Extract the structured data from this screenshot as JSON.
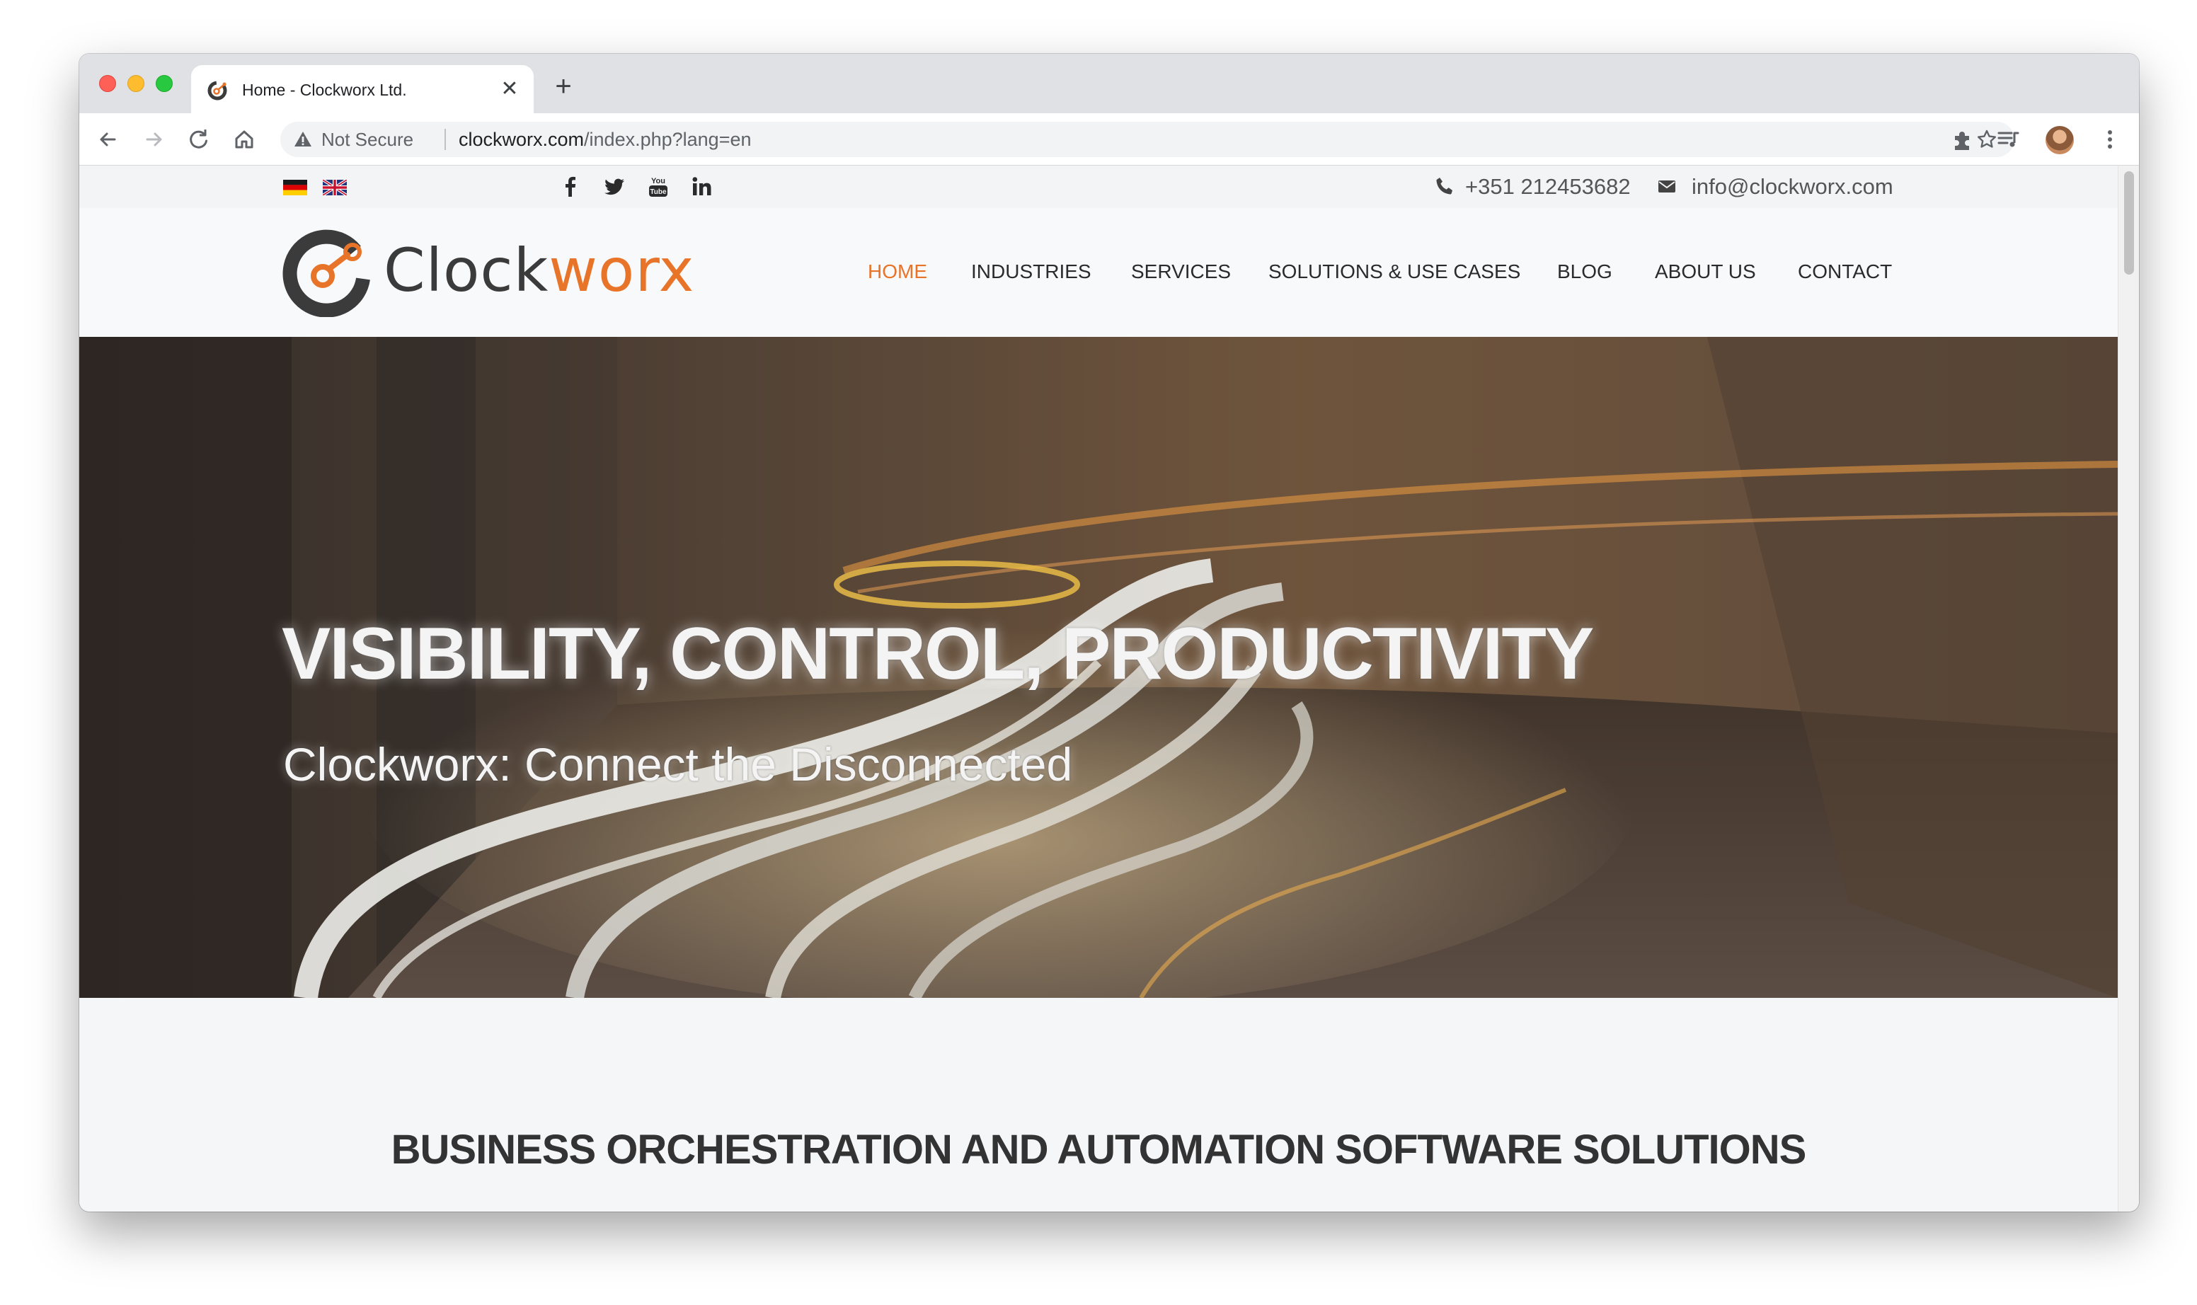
{
  "browser": {
    "tab_title": "Home - Clockworx Ltd.",
    "tab_close": "✕",
    "new_tab": "+",
    "security_label": "Not Secure",
    "url_domain": "clockworx.com",
    "url_path": "/index.php?lang=en"
  },
  "topbar": {
    "languages": [
      "German",
      "English"
    ],
    "social": [
      "facebook-icon",
      "twitter-icon",
      "youtube-icon",
      "linkedin-icon"
    ],
    "phone": "+351 212453682",
    "email": "info@clockworx.com"
  },
  "logo": {
    "part1": "Clock",
    "part2": "worx"
  },
  "nav": {
    "home": "HOME",
    "industries": "INDUSTRIES",
    "services": "SERVICES",
    "solutions": "SOLUTIONS & USE CASES",
    "blog": "BLOG",
    "about": "ABOUT US",
    "contact": "CONTACT"
  },
  "hero": {
    "title": "VISIBILITY, CONTROL, PRODUCTIVITY",
    "subtitle": "Clockworx: Connect the Disconnected"
  },
  "section": {
    "title": "BUSINESS ORCHESTRATION AND AUTOMATION SOFTWARE SOLUTIONS"
  },
  "colors": {
    "brand_orange": "#e8742a",
    "brand_dark": "#3b3b3b"
  }
}
